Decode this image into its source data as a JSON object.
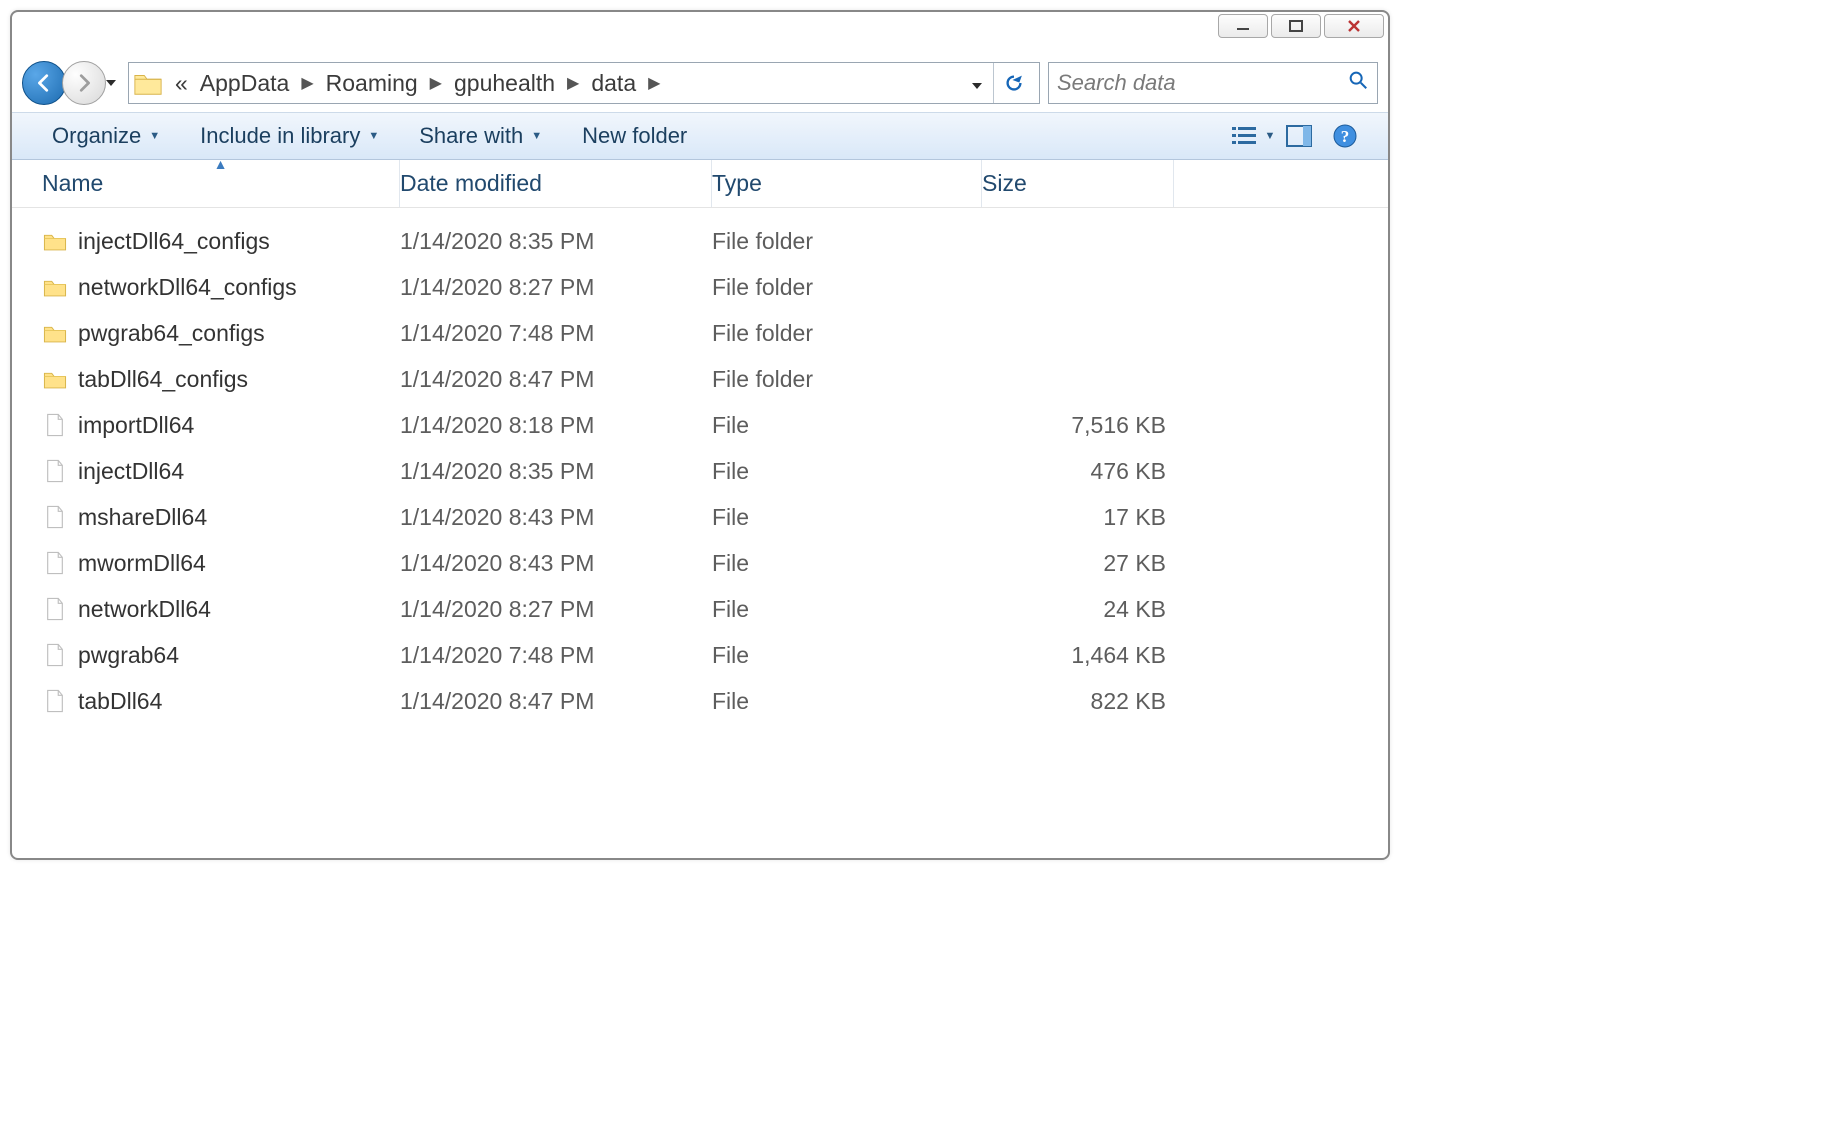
{
  "titlebar": {},
  "nav": {
    "breadcrumb_prefix": "«",
    "crumbs": [
      "AppData",
      "Roaming",
      "gpuhealth",
      "data"
    ]
  },
  "search": {
    "placeholder": "Search data"
  },
  "commandbar": {
    "organize": "Organize",
    "include": "Include in library",
    "share": "Share with",
    "newfolder": "New folder"
  },
  "columns": {
    "name": "Name",
    "date": "Date modified",
    "type": "Type",
    "size": "Size"
  },
  "items": [
    {
      "name": "injectDll64_configs",
      "date": "1/14/2020 8:35 PM",
      "type": "File folder",
      "size": "",
      "kind": "folder"
    },
    {
      "name": "networkDll64_configs",
      "date": "1/14/2020 8:27 PM",
      "type": "File folder",
      "size": "",
      "kind": "folder"
    },
    {
      "name": "pwgrab64_configs",
      "date": "1/14/2020 7:48 PM",
      "type": "File folder",
      "size": "",
      "kind": "folder"
    },
    {
      "name": "tabDll64_configs",
      "date": "1/14/2020 8:47 PM",
      "type": "File folder",
      "size": "",
      "kind": "folder"
    },
    {
      "name": "importDll64",
      "date": "1/14/2020 8:18 PM",
      "type": "File",
      "size": "7,516 KB",
      "kind": "file"
    },
    {
      "name": "injectDll64",
      "date": "1/14/2020 8:35 PM",
      "type": "File",
      "size": "476 KB",
      "kind": "file"
    },
    {
      "name": "mshareDll64",
      "date": "1/14/2020 8:43 PM",
      "type": "File",
      "size": "17 KB",
      "kind": "file"
    },
    {
      "name": "mwormDll64",
      "date": "1/14/2020 8:43 PM",
      "type": "File",
      "size": "27 KB",
      "kind": "file"
    },
    {
      "name": "networkDll64",
      "date": "1/14/2020 8:27 PM",
      "type": "File",
      "size": "24 KB",
      "kind": "file"
    },
    {
      "name": "pwgrab64",
      "date": "1/14/2020 7:48 PM",
      "type": "File",
      "size": "1,464 KB",
      "kind": "file"
    },
    {
      "name": "tabDll64",
      "date": "1/14/2020 8:47 PM",
      "type": "File",
      "size": "822 KB",
      "kind": "file"
    }
  ]
}
